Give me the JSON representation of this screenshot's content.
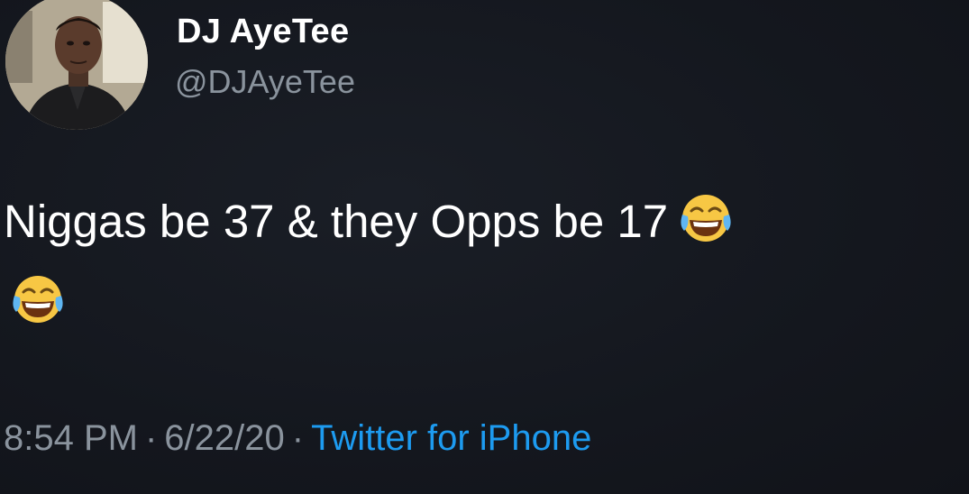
{
  "user": {
    "display_name": "DJ AyeTee",
    "handle": "@DJAyeTee",
    "avatar_icon": "profile-photo"
  },
  "tweet": {
    "text": "Niggas be 37 & they Opps be 17",
    "emoji": [
      "face-with-tears-of-joy-icon",
      "face-with-tears-of-joy-icon"
    ]
  },
  "meta": {
    "time": "8:54 PM",
    "separator": "·",
    "date": "6/22/20",
    "source": "Twitter for iPhone"
  },
  "colors": {
    "background": "#15181f",
    "secondary_text": "#8a939d",
    "link": "#1d9bf0"
  }
}
